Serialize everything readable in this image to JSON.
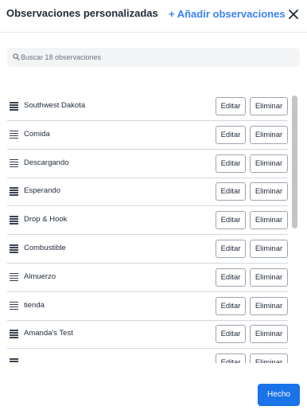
{
  "header": {
    "title": "Observaciones personalizadas",
    "add_label": "+ Añadir observaciones",
    "close_icon": "close-icon"
  },
  "search": {
    "placeholder": "Buscar 18 observaciones",
    "value": ""
  },
  "list": {
    "edit_label": "Editar",
    "delete_label": "Eliminar",
    "handle_icon": "drag-handle-icon",
    "items": [
      {
        "label": "Southwest Dakota"
      },
      {
        "label": "Comida"
      },
      {
        "label": "Descargando"
      },
      {
        "label": "Esperando"
      },
      {
        "label": "Drop & Hook"
      },
      {
        "label": "Combustible"
      },
      {
        "label": "Almuerzo"
      },
      {
        "label": "tienda"
      },
      {
        "label": "Amanda's Test"
      },
      {
        "label": ""
      }
    ]
  },
  "footer": {
    "done_label": "Hecho"
  },
  "colors": {
    "accent": "#3b82f6",
    "primary_button": "#1a73e8"
  }
}
